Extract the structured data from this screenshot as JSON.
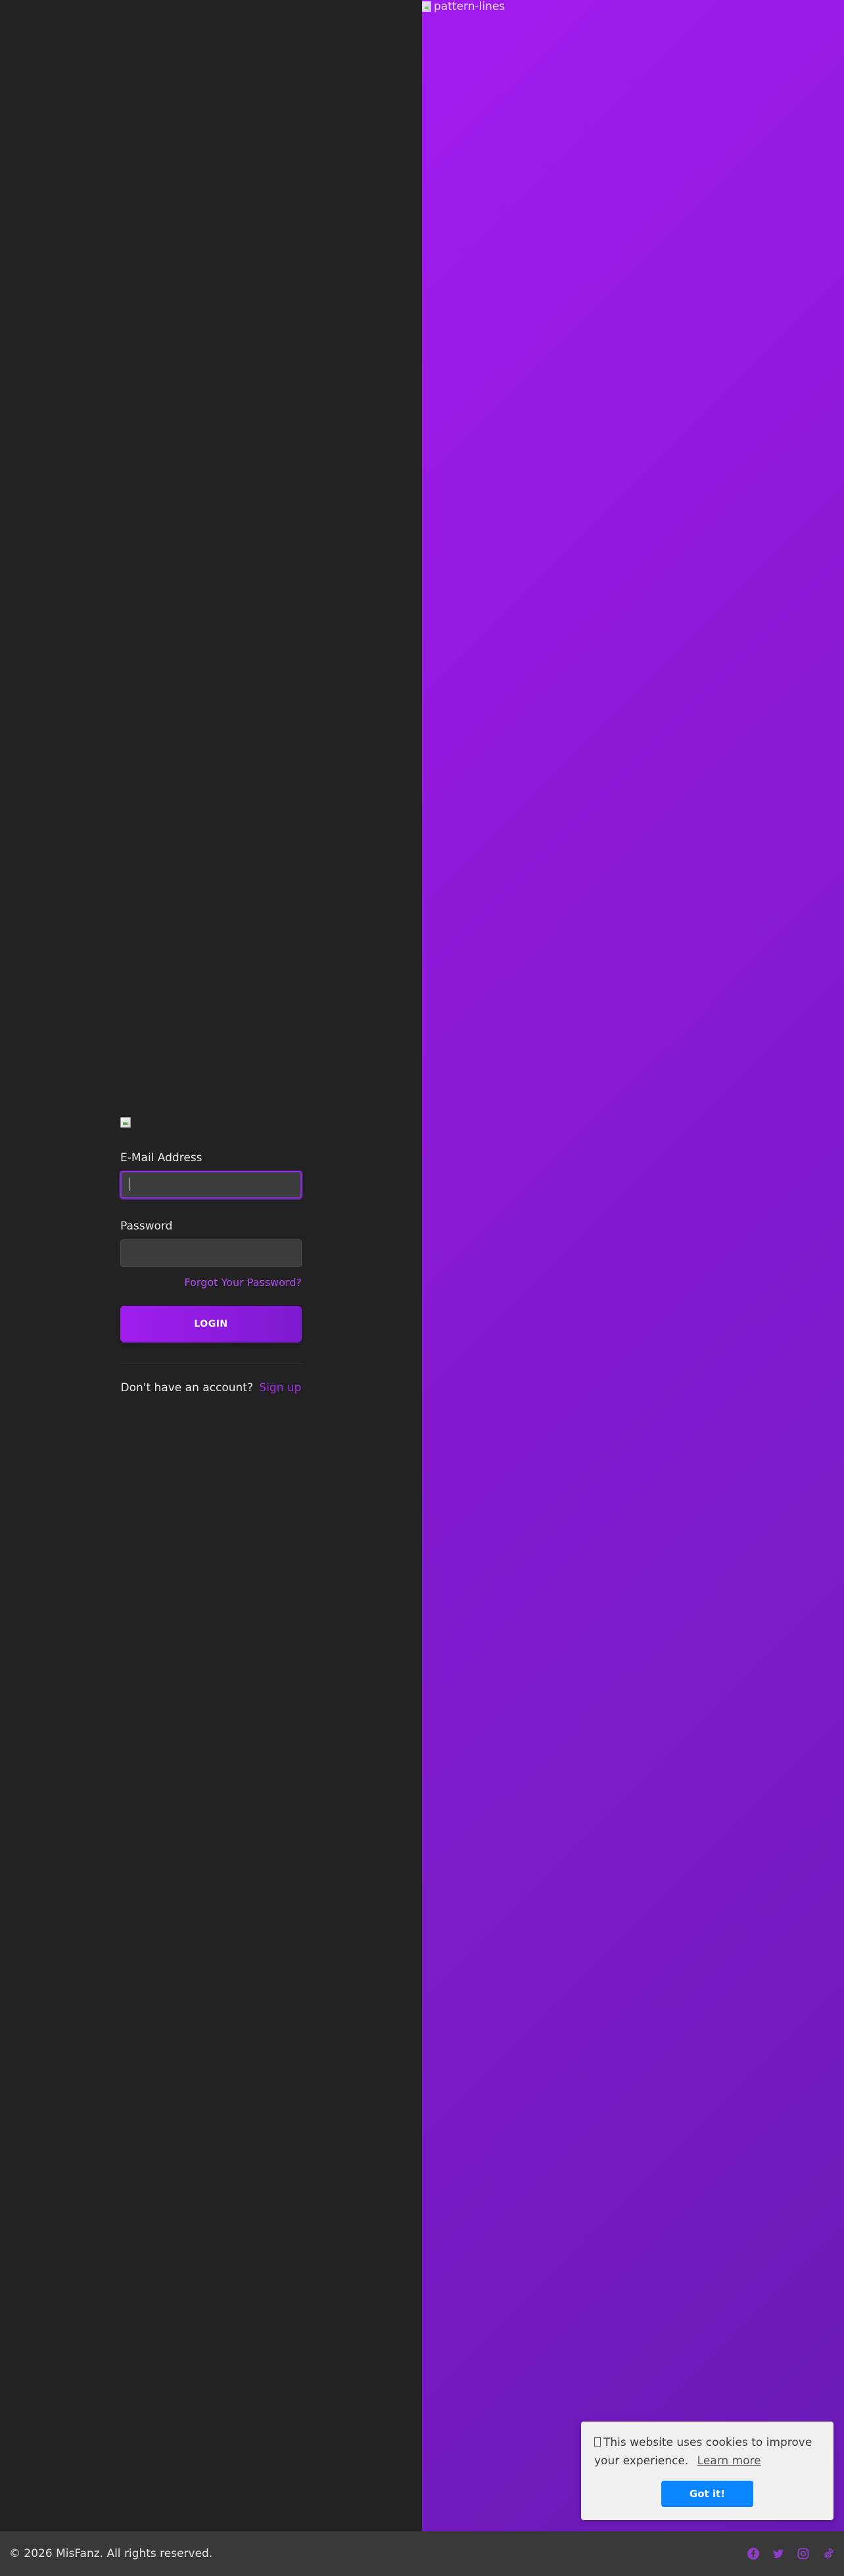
{
  "hero": {
    "image_alt": "pattern-lines"
  },
  "login": {
    "email_label": "E-Mail Address",
    "email_value": "",
    "password_label": "Password",
    "password_value": "",
    "forgot_link": "Forgot Your Password?",
    "login_button": "LOGIN",
    "signup_prompt": "Don't have an account?",
    "signup_link": "Sign up"
  },
  "cookie": {
    "message": "This website uses cookies to improve your experience.",
    "learn_more": "Learn more",
    "button": "Got it!"
  },
  "footer": {
    "copyright": "© 2026 MisFanz. All rights reserved.",
    "social": [
      "facebook-icon",
      "twitter-icon",
      "instagram-icon",
      "tiktok-icon"
    ]
  },
  "colors": {
    "accent": "#9f1ced",
    "accent_link": "#b44cf2",
    "cookie_button": "#0a84ff",
    "dark_bg": "#222222",
    "footer_bg": "#393939"
  }
}
